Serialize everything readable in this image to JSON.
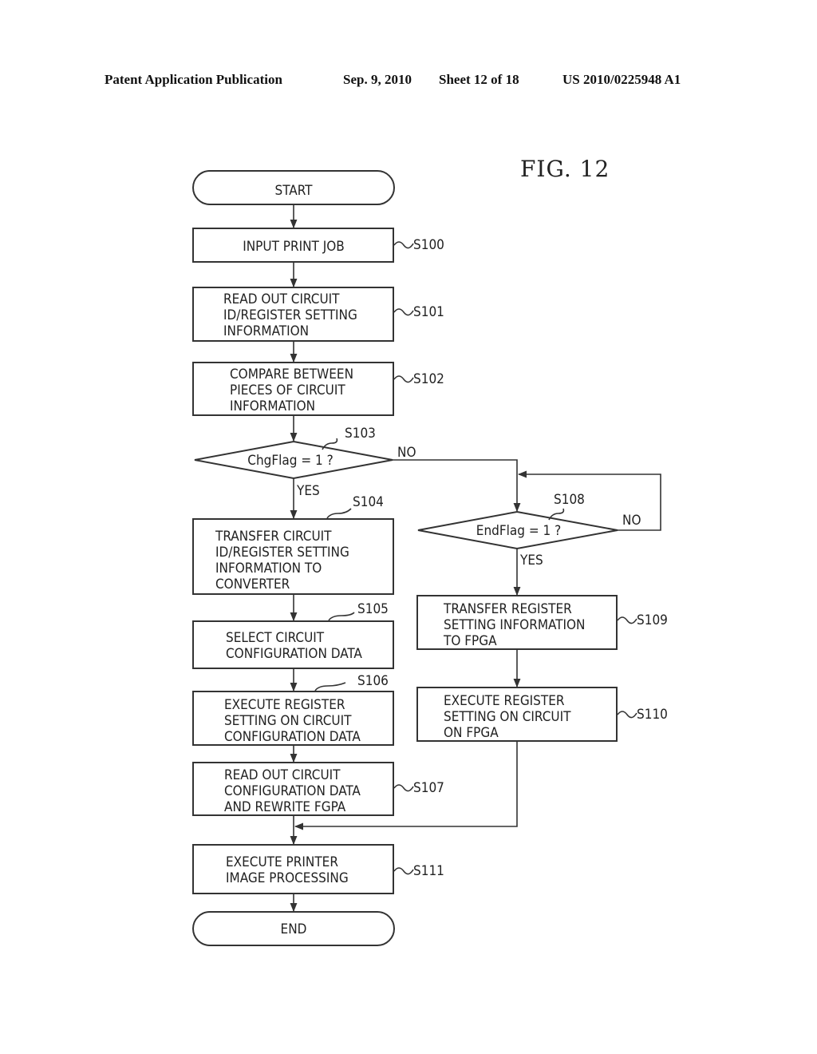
{
  "header": {
    "publication": "Patent Application Publication",
    "date": "Sep. 9, 2010",
    "sheet": "Sheet 12 of 18",
    "number": "US 2010/0225948 A1"
  },
  "figure_label": "FIG. 12",
  "flowchart": {
    "start": "START",
    "end": "END",
    "steps": {
      "S100": {
        "id": "S100",
        "lines": [
          "INPUT PRINT JOB"
        ]
      },
      "S101": {
        "id": "S101",
        "lines": [
          "READ OUT CIRCUIT",
          "ID/REGISTER SETTING",
          "INFORMATION"
        ]
      },
      "S102": {
        "id": "S102",
        "lines": [
          "COMPARE BETWEEN",
          "PIECES OF CIRCUIT",
          "INFORMATION"
        ]
      },
      "S103": {
        "id": "S103",
        "lines": [
          "ChgFlag = 1 ?"
        ]
      },
      "S104": {
        "id": "S104",
        "lines": [
          "TRANSFER CIRCUIT",
          "ID/REGISTER SETTING",
          "INFORMATION TO",
          "CONVERTER"
        ]
      },
      "S105": {
        "id": "S105",
        "lines": [
          "SELECT CIRCUIT",
          "CONFIGURATION DATA"
        ]
      },
      "S106": {
        "id": "S106",
        "lines": [
          "EXECUTE REGISTER",
          "SETTING ON CIRCUIT",
          "CONFIGURATION DATA"
        ]
      },
      "S107": {
        "id": "S107",
        "lines": [
          "READ OUT CIRCUIT",
          "CONFIGURATION DATA",
          "AND REWRITE FGPA"
        ]
      },
      "S108": {
        "id": "S108",
        "lines": [
          "EndFlag = 1 ?"
        ]
      },
      "S109": {
        "id": "S109",
        "lines": [
          "TRANSFER REGISTER",
          "SETTING INFORMATION",
          "TO FPGA"
        ]
      },
      "S110": {
        "id": "S110",
        "lines": [
          "EXECUTE REGISTER",
          "SETTING ON CIRCUIT",
          "ON FPGA"
        ]
      },
      "S111": {
        "id": "S111",
        "lines": [
          "EXECUTE PRINTER",
          "IMAGE PROCESSING"
        ]
      }
    },
    "branch_labels": {
      "s103_yes": "YES",
      "s103_no": "NO",
      "s108_yes": "YES",
      "s108_no": "NO"
    }
  }
}
